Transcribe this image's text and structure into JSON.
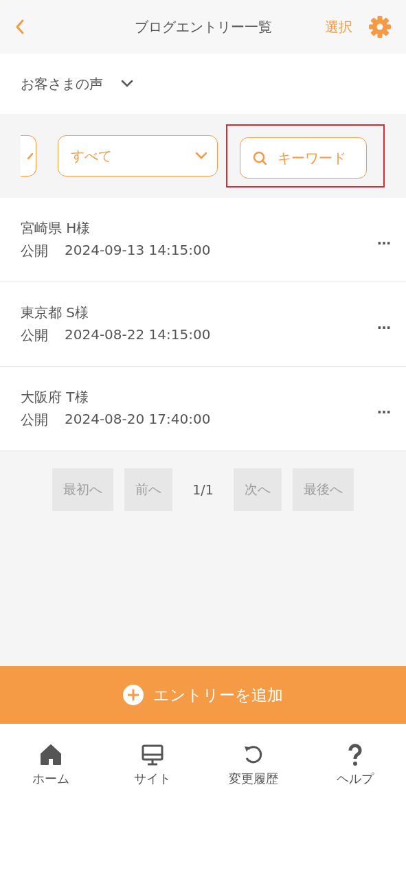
{
  "header": {
    "title": "ブログエントリー一覧",
    "select": "選択"
  },
  "category": {
    "label": "お客さまの声"
  },
  "filters": {
    "status": {
      "value": "すべて"
    },
    "keyword": {
      "label": "キーワード",
      "highlighted": true
    }
  },
  "entries": [
    {
      "title": "宮崎県 H様",
      "status": "公開",
      "date": "2024-09-13 14:15:00",
      "menu": "…"
    },
    {
      "title": "東京都 S様",
      "status": "公開",
      "date": "2024-08-22 14:15:00",
      "menu": "…"
    },
    {
      "title": "大阪府 T様",
      "status": "公開",
      "date": "2024-08-20 17:40:00",
      "menu": "…"
    }
  ],
  "pagination": [
    {
      "kind": "button",
      "label": "最初へ",
      "disabled": true
    },
    {
      "kind": "button",
      "label": "前へ",
      "disabled": true
    },
    {
      "kind": "page",
      "label": "1/1"
    },
    {
      "kind": "button",
      "label": "次へ",
      "disabled": true
    },
    {
      "kind": "button",
      "label": "最後へ",
      "disabled": true
    }
  ],
  "add_button": {
    "label": "エントリーを追加"
  },
  "tab_bar": [
    {
      "kind": "home",
      "label": "ホーム"
    },
    {
      "kind": "site",
      "label": "サイト"
    },
    {
      "kind": "history",
      "label": "変更履歴"
    },
    {
      "kind": "help",
      "label": "ヘルプ"
    }
  ]
}
